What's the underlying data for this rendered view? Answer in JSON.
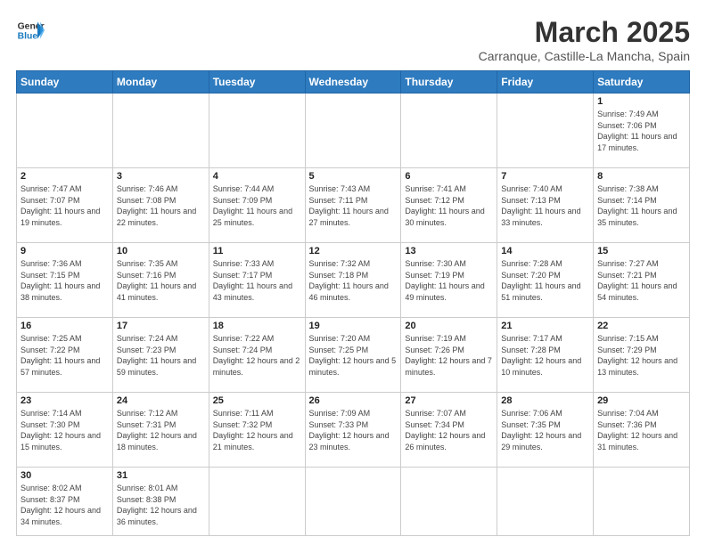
{
  "header": {
    "logo_text_general": "General",
    "logo_text_blue": "Blue",
    "month": "March 2025",
    "location": "Carranque, Castille-La Mancha, Spain"
  },
  "weekdays": [
    "Sunday",
    "Monday",
    "Tuesday",
    "Wednesday",
    "Thursday",
    "Friday",
    "Saturday"
  ],
  "weeks": [
    [
      null,
      null,
      null,
      null,
      null,
      null,
      {
        "day": "1",
        "sunrise": "7:49 AM",
        "sunset": "7:06 PM",
        "daylight": "11 hours and 17 minutes."
      }
    ],
    [
      {
        "day": "2",
        "sunrise": "7:47 AM",
        "sunset": "7:07 PM",
        "daylight": "11 hours and 19 minutes."
      },
      {
        "day": "3",
        "sunrise": "7:46 AM",
        "sunset": "7:08 PM",
        "daylight": "11 hours and 22 minutes."
      },
      {
        "day": "4",
        "sunrise": "7:44 AM",
        "sunset": "7:09 PM",
        "daylight": "11 hours and 25 minutes."
      },
      {
        "day": "5",
        "sunrise": "7:43 AM",
        "sunset": "7:11 PM",
        "daylight": "11 hours and 27 minutes."
      },
      {
        "day": "6",
        "sunrise": "7:41 AM",
        "sunset": "7:12 PM",
        "daylight": "11 hours and 30 minutes."
      },
      {
        "day": "7",
        "sunrise": "7:40 AM",
        "sunset": "7:13 PM",
        "daylight": "11 hours and 33 minutes."
      },
      {
        "day": "8",
        "sunrise": "7:38 AM",
        "sunset": "7:14 PM",
        "daylight": "11 hours and 35 minutes."
      }
    ],
    [
      {
        "day": "9",
        "sunrise": "7:36 AM",
        "sunset": "7:15 PM",
        "daylight": "11 hours and 38 minutes."
      },
      {
        "day": "10",
        "sunrise": "7:35 AM",
        "sunset": "7:16 PM",
        "daylight": "11 hours and 41 minutes."
      },
      {
        "day": "11",
        "sunrise": "7:33 AM",
        "sunset": "7:17 PM",
        "daylight": "11 hours and 43 minutes."
      },
      {
        "day": "12",
        "sunrise": "7:32 AM",
        "sunset": "7:18 PM",
        "daylight": "11 hours and 46 minutes."
      },
      {
        "day": "13",
        "sunrise": "7:30 AM",
        "sunset": "7:19 PM",
        "daylight": "11 hours and 49 minutes."
      },
      {
        "day": "14",
        "sunrise": "7:28 AM",
        "sunset": "7:20 PM",
        "daylight": "11 hours and 51 minutes."
      },
      {
        "day": "15",
        "sunrise": "7:27 AM",
        "sunset": "7:21 PM",
        "daylight": "11 hours and 54 minutes."
      }
    ],
    [
      {
        "day": "16",
        "sunrise": "7:25 AM",
        "sunset": "7:22 PM",
        "daylight": "11 hours and 57 minutes."
      },
      {
        "day": "17",
        "sunrise": "7:24 AM",
        "sunset": "7:23 PM",
        "daylight": "11 hours and 59 minutes."
      },
      {
        "day": "18",
        "sunrise": "7:22 AM",
        "sunset": "7:24 PM",
        "daylight": "12 hours and 2 minutes."
      },
      {
        "day": "19",
        "sunrise": "7:20 AM",
        "sunset": "7:25 PM",
        "daylight": "12 hours and 5 minutes."
      },
      {
        "day": "20",
        "sunrise": "7:19 AM",
        "sunset": "7:26 PM",
        "daylight": "12 hours and 7 minutes."
      },
      {
        "day": "21",
        "sunrise": "7:17 AM",
        "sunset": "7:28 PM",
        "daylight": "12 hours and 10 minutes."
      },
      {
        "day": "22",
        "sunrise": "7:15 AM",
        "sunset": "7:29 PM",
        "daylight": "12 hours and 13 minutes."
      }
    ],
    [
      {
        "day": "23",
        "sunrise": "7:14 AM",
        "sunset": "7:30 PM",
        "daylight": "12 hours and 15 minutes."
      },
      {
        "day": "24",
        "sunrise": "7:12 AM",
        "sunset": "7:31 PM",
        "daylight": "12 hours and 18 minutes."
      },
      {
        "day": "25",
        "sunrise": "7:11 AM",
        "sunset": "7:32 PM",
        "daylight": "12 hours and 21 minutes."
      },
      {
        "day": "26",
        "sunrise": "7:09 AM",
        "sunset": "7:33 PM",
        "daylight": "12 hours and 23 minutes."
      },
      {
        "day": "27",
        "sunrise": "7:07 AM",
        "sunset": "7:34 PM",
        "daylight": "12 hours and 26 minutes."
      },
      {
        "day": "28",
        "sunrise": "7:06 AM",
        "sunset": "7:35 PM",
        "daylight": "12 hours and 29 minutes."
      },
      {
        "day": "29",
        "sunrise": "7:04 AM",
        "sunset": "7:36 PM",
        "daylight": "12 hours and 31 minutes."
      }
    ],
    [
      {
        "day": "30",
        "sunrise": "8:02 AM",
        "sunset": "8:37 PM",
        "daylight": "12 hours and 34 minutes."
      },
      {
        "day": "31",
        "sunrise": "8:01 AM",
        "sunset": "8:38 PM",
        "daylight": "12 hours and 36 minutes."
      },
      null,
      null,
      null,
      null,
      null
    ]
  ]
}
